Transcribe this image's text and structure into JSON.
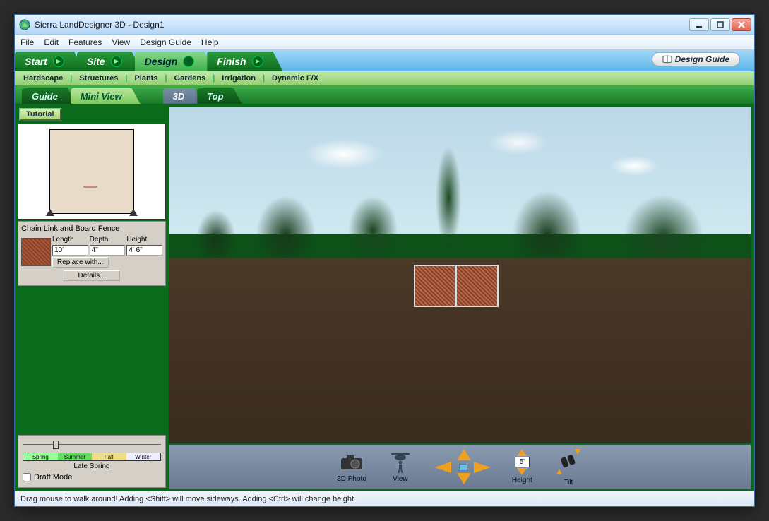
{
  "window": {
    "title": "Sierra LandDesigner 3D - Design1"
  },
  "menu": [
    "File",
    "Edit",
    "Features",
    "View",
    "Design Guide",
    "Help"
  ],
  "navTabs": {
    "start": "Start",
    "site": "Site",
    "design": "Design",
    "finish": "Finish",
    "guideBtn": "Design Guide"
  },
  "subTabs": [
    "Hardscape",
    "Structures",
    "Plants",
    "Gardens",
    "Irrigation",
    "Dynamic F/X"
  ],
  "viewTabs": {
    "guide": "Guide",
    "miniview": "Mini View",
    "threeD": "3D",
    "top": "Top"
  },
  "sidebar": {
    "tutorial": "Tutorial",
    "objectName": "Chain Link and Board Fence",
    "headers": {
      "length": "Length",
      "depth": "Depth",
      "height": "Height"
    },
    "values": {
      "length": "10'",
      "depth": "4\"",
      "height": "4' 6\""
    },
    "replaceBtn": "Replace with...",
    "detailsBtn": "Details...",
    "seasons": {
      "spring": "Spring",
      "summer": "Summer",
      "fall": "Fall",
      "winter": "Winter"
    },
    "seasonLabel": "Late Spring",
    "draftMode": "Draft Mode"
  },
  "toolbar3d": {
    "photo": "3D Photo",
    "view": "View",
    "height": "Height",
    "heightValue": "5'",
    "tilt": "Tilt"
  },
  "status": "Drag mouse to walk around!  Adding <Shift> will move sideways. Adding <Ctrl> will change height"
}
